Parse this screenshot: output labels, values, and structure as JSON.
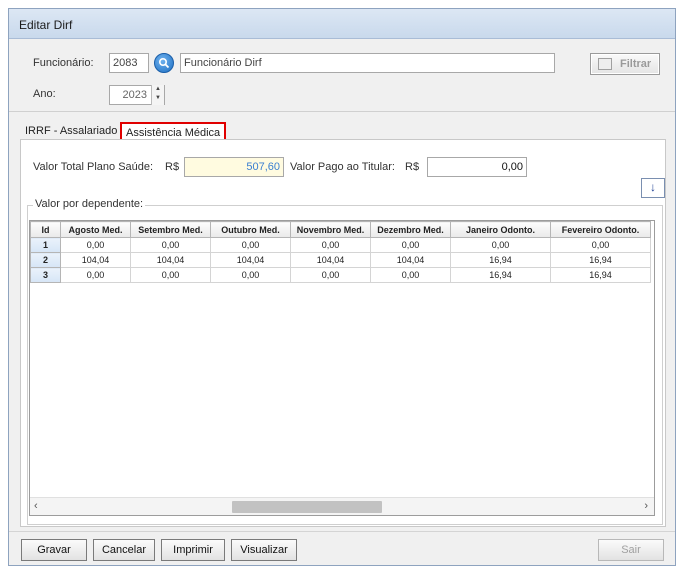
{
  "window": {
    "title": "Editar Dirf"
  },
  "filter": {
    "funcionario_label": "Funcionário:",
    "funcionario_code": "2083",
    "funcionario_name": "Funcionário Dirf",
    "ano_label": "Ano:",
    "ano_value": "2023",
    "filtrar_label": "Filtrar"
  },
  "tabs": [
    {
      "label": "IRRF - Assalariado",
      "active": false
    },
    {
      "label": "Assistência Médica",
      "active": true
    }
  ],
  "medical": {
    "total_label": "Valor Total Plano Saúde:",
    "total_currency": "R$",
    "total_value": "507,60",
    "titular_label": "Valor Pago ao Titular:",
    "titular_currency": "R$",
    "titular_value": "0,00",
    "group_label": "Valor por dependente:"
  },
  "grid": {
    "columns": [
      "Id",
      "Agosto Med.",
      "Setembro Med.",
      "Outubro Med.",
      "Novembro Med.",
      "Dezembro Med.",
      "Janeiro Odonto.",
      "Fevereiro Odonto."
    ],
    "rows": [
      [
        "1",
        "0,00",
        "0,00",
        "0,00",
        "0,00",
        "0,00",
        "0,00",
        "0,00"
      ],
      [
        "2",
        "104,04",
        "104,04",
        "104,04",
        "104,04",
        "104,04",
        "16,94",
        "16,94"
      ],
      [
        "3",
        "0,00",
        "0,00",
        "0,00",
        "0,00",
        "0,00",
        "16,94",
        "16,94"
      ]
    ]
  },
  "footer": {
    "gravar": "Gravar",
    "cancelar": "Cancelar",
    "imprimir": "Imprimir",
    "visualizar": "Visualizar",
    "sair": "Sair"
  },
  "colors": {
    "accent": "#1e6fc2",
    "highlight_field": "#fffbe0",
    "active_tab_border": "#e00000"
  },
  "icons": [
    "search-icon",
    "filter-icon",
    "arrow-down-icon",
    "spin-up-icon",
    "spin-down-icon",
    "scroll-left-icon",
    "scroll-right-icon"
  ]
}
